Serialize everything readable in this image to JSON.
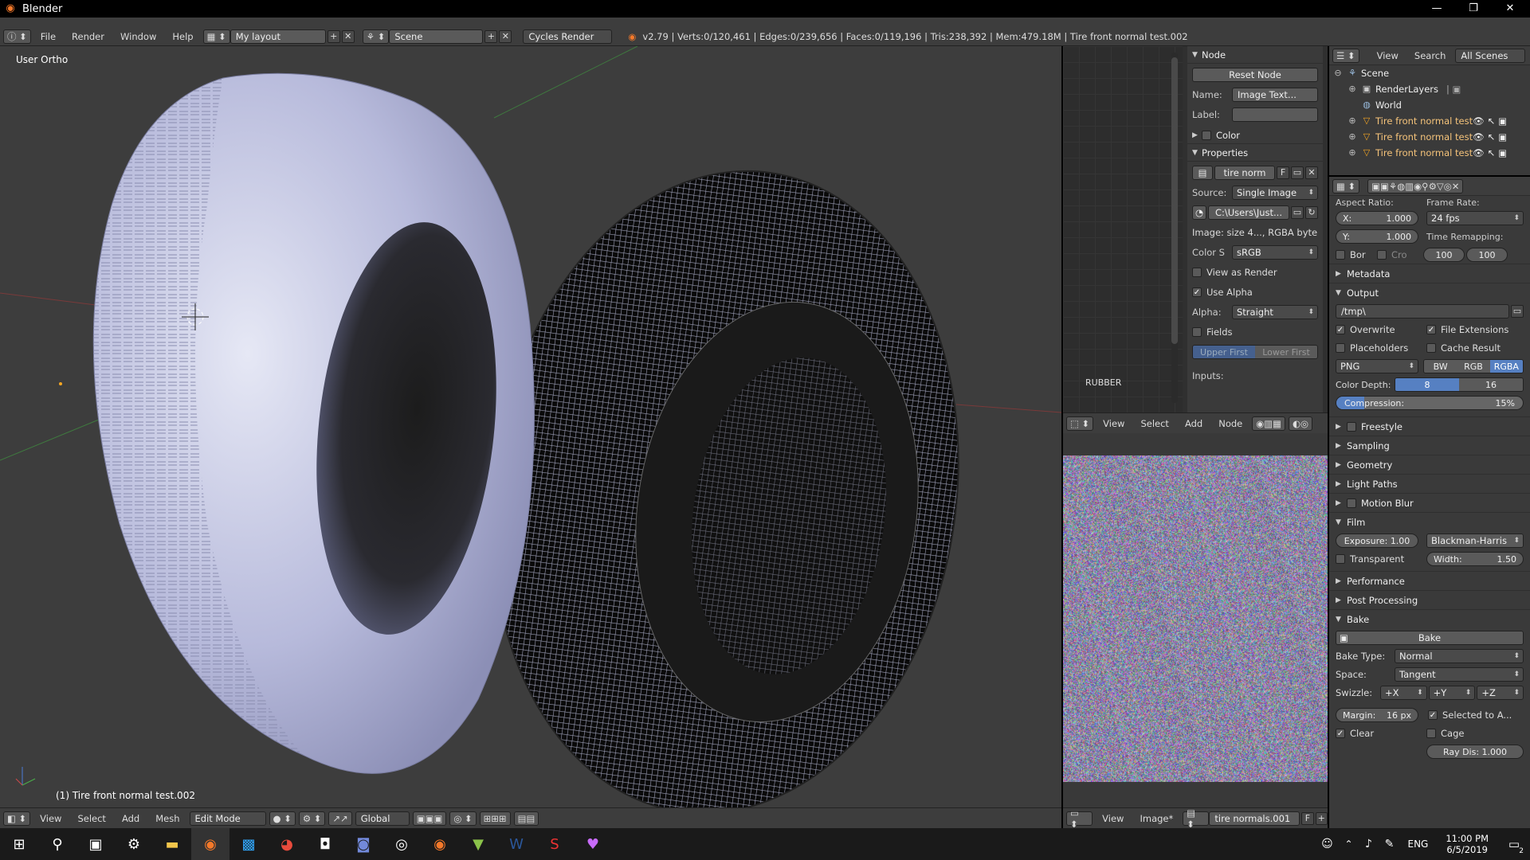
{
  "window": {
    "title": "Blender",
    "icon": "blender-logo-icon"
  },
  "infobar": {
    "menus": [
      "File",
      "Render",
      "Window",
      "Help"
    ],
    "layout": "My layout",
    "scene": "Scene",
    "engine": "Cycles Render",
    "stats": "v2.79 | Verts:0/120,461 | Edges:0/239,656 | Faces:0/119,196 | Tris:238,392 | Mem:479.18M | Tire front normal test.002"
  },
  "viewport": {
    "view_label": "User Ortho",
    "object_label": "(1) Tire front normal test.002",
    "header": {
      "menus": [
        "View",
        "Select",
        "Add",
        "Mesh"
      ],
      "mode": "Edit Mode",
      "orientation": "Global"
    }
  },
  "node_editor": {
    "panel_title": "Node",
    "reset_button": "Reset Node",
    "name_label": "Name:",
    "name_value": "Image Text...",
    "label_label": "Label:",
    "color_section": "Color",
    "properties_section": "Properties",
    "image_name": "tire norm",
    "image_fake": "F",
    "source_label": "Source:",
    "source_value": "Single Image",
    "path_value": "C:\\Users\\Just...",
    "image_info": "Image: size 4..., RGBA byte",
    "colorspace_label": "Color S",
    "colorspace_value": "sRGB",
    "view_as_render": "View as Render",
    "use_alpha": "Use Alpha",
    "alpha_label": "Alpha:",
    "alpha_value": "Straight",
    "fields": "Fields",
    "upper_first": "Upper First",
    "lower_first": "Lower First",
    "inputs_label": "Inputs:",
    "material_label": "RUBBER",
    "header_menus": [
      "View",
      "Select",
      "Add",
      "Node"
    ]
  },
  "image_editor": {
    "header_menus": [
      "View",
      "Image*"
    ],
    "image_name": "tire normals.001",
    "fake_user": "F"
  },
  "outliner": {
    "header": {
      "view": "View",
      "search": "Search",
      "filter": "All Scenes"
    },
    "items": [
      {
        "label": "Scene",
        "icon": "scene-icon"
      },
      {
        "label": "RenderLayers",
        "icon": "renderlayers-icon"
      },
      {
        "label": "World",
        "icon": "world-icon"
      },
      {
        "label": "Tire front normal test.0",
        "icon": "mesh-object-icon"
      },
      {
        "label": "Tire front normal test.0",
        "icon": "mesh-object-icon"
      },
      {
        "label": "Tire front normal test.0",
        "icon": "mesh-object-icon"
      }
    ]
  },
  "properties": {
    "aspect_ratio": "Aspect Ratio:",
    "frame_rate": "Frame Rate:",
    "x_label": "X:",
    "x_value": "1.000",
    "y_label": "Y:",
    "y_value": "1.000",
    "fps": "24 fps",
    "time_remapping": "Time Remapping:",
    "bor": "Bor",
    "cro": "Cro",
    "remap_old": "100",
    "remap_new": "100",
    "sections": {
      "metadata": "Metadata",
      "output": "Output",
      "freestyle": "Freestyle",
      "sampling": "Sampling",
      "geometry": "Geometry",
      "light_paths": "Light Paths",
      "motion_blur": "Motion Blur",
      "film": "Film",
      "performance": "Performance",
      "post_processing": "Post Processing",
      "bake": "Bake"
    },
    "output_path": "/tmp\\",
    "overwrite": "Overwrite",
    "file_extensions": "File Extensions",
    "placeholders": "Placeholders",
    "cache_result": "Cache Result",
    "format": "PNG",
    "color_modes": [
      "BW",
      "RGB",
      "RGBA"
    ],
    "color_depth_label": "Color Depth:",
    "color_depths": [
      "8",
      "16"
    ],
    "compression_label": "Compression:",
    "compression_value": "15%",
    "compression_fraction": 0.15,
    "exposure": "Exposure: 1.00",
    "filter": "Blackman-Harris",
    "transparent": "Transparent",
    "width": "Width:",
    "width_value": "1.50",
    "bake_button": "Bake",
    "bake_type_label": "Bake Type:",
    "bake_type": "Normal",
    "space_label": "Space:",
    "space_value": "Tangent",
    "swizzle_label": "Swizzle:",
    "swizzle": [
      "+X",
      "+Y",
      "+Z"
    ],
    "margin": "Margin:",
    "margin_value": "16 px",
    "selected_to_active": "Selected to A...",
    "clear": "Clear",
    "cage": "Cage",
    "ray_dis": "Ray Dis: 1.000"
  },
  "taskbar": {
    "language": "ENG",
    "time": "11:00 PM",
    "date": "6/5/2019",
    "notification_count": "2"
  }
}
